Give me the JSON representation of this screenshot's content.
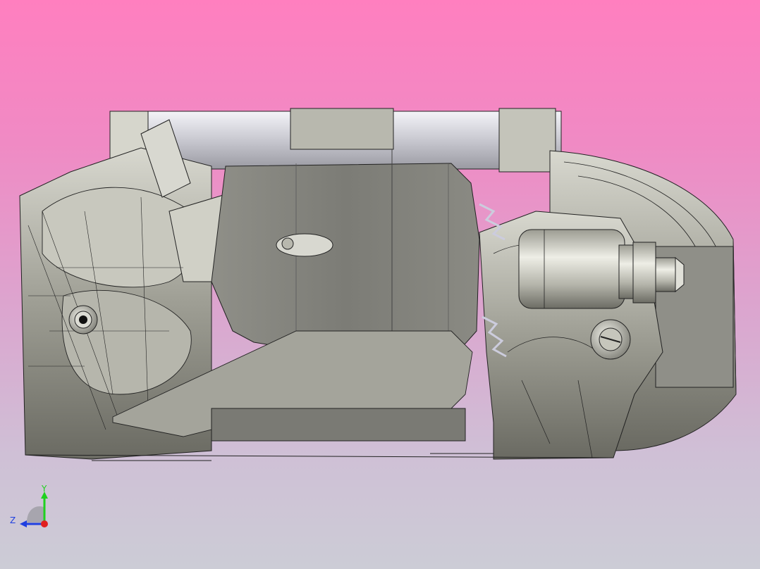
{
  "viewport": {
    "background_top": "#ff7fbf",
    "background_bottom": "#ccccd6"
  },
  "model": {
    "name_icon": "caliper-3d-model",
    "shade_light": "#e4e4dc",
    "shade_mid": "#a8a89e",
    "shade_dark": "#6e6e66",
    "edge_color": "#1e1e1e",
    "pad_color": "#8a8a82"
  },
  "triad": {
    "y_label": "Y",
    "z_label": "Z",
    "y_color": "#1fd11f",
    "z_color": "#1f3fe0",
    "x_color": "#e01f1f"
  }
}
